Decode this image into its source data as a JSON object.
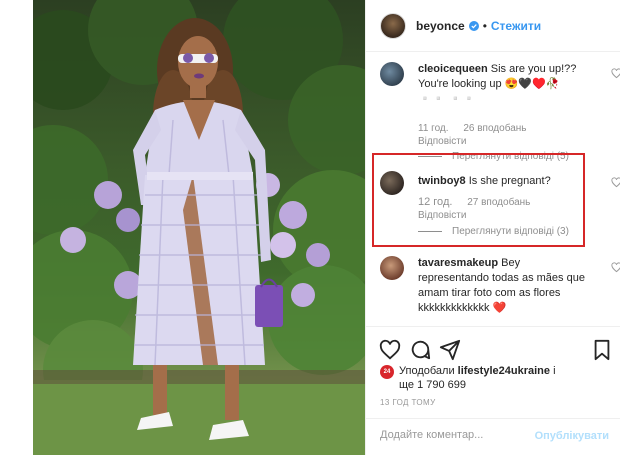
{
  "post": {
    "photo_alt": "",
    "author": "beyonce",
    "follow_label": "Стежити",
    "separator": "•"
  },
  "comments": [
    {
      "user": "cleoicequeen",
      "text": "Sis are you up!?? You're looking up 😍🖤♥️🥀 ▫️▫️ ▫️▫️",
      "time": "11 год.",
      "likes": "26 вподобань",
      "reply": "Відповісти",
      "view_replies": "Переглянути відповіді (5)"
    },
    {
      "user": "twinboy8",
      "text": "Is she pregnant?",
      "time": "12 год.",
      "likes": "27 вподобань",
      "reply": "Відповісти",
      "view_replies": "Переглянути відповіді (3)"
    },
    {
      "user": "tavaresmakeup",
      "text": "Bey representando todas as mães que amam tirar foto com as flores kkkkkkkkkkkkk ❤️",
      "time": "",
      "likes": "",
      "reply": ""
    }
  ],
  "liked_by": {
    "badge": "24",
    "prefix": "Уподобали",
    "account": "lifestyle24ukraine",
    "suffix": "і",
    "count_text": "ще 1 790 699"
  },
  "time_ago": "13 ГОД ТОМУ",
  "add_comment": {
    "placeholder": "Додайте коментар...",
    "post_label": "Опублікувати"
  },
  "colors": {
    "link_blue": "#3897f0",
    "highlight_red": "#d62728",
    "muted_text": "#8e8e8e"
  },
  "icons": [
    "heart-icon",
    "comment-icon",
    "share-icon",
    "bookmark-icon",
    "verified-badge-icon"
  ]
}
